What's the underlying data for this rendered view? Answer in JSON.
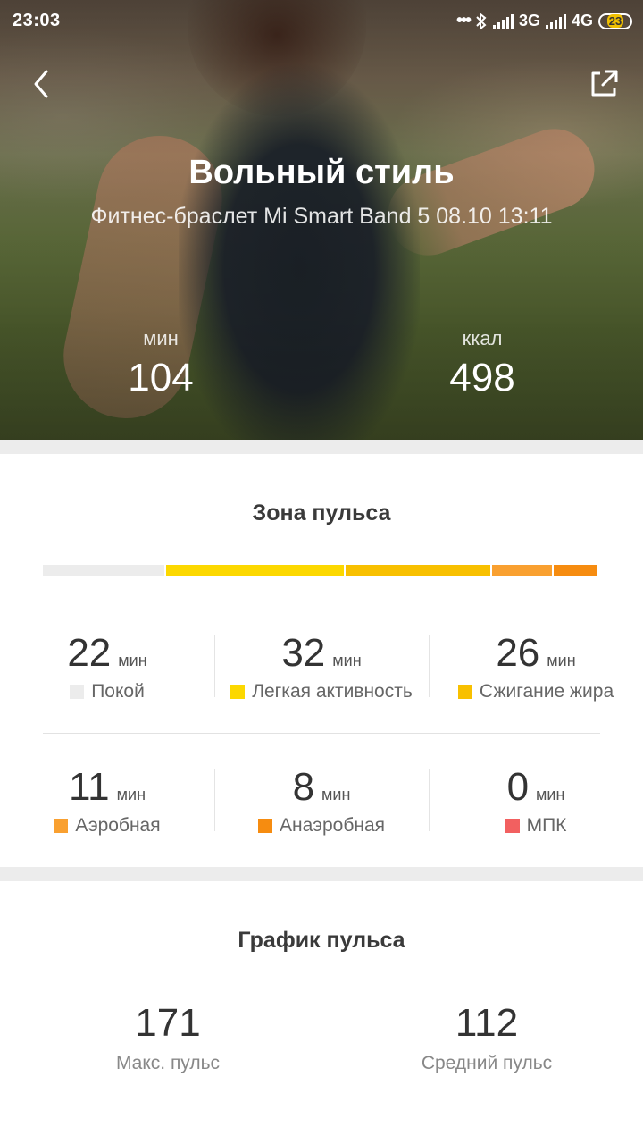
{
  "status_bar": {
    "time": "23:03",
    "net1": "3G",
    "net2": "4G",
    "battery": "23"
  },
  "header": {
    "title": "Вольный стиль",
    "subtitle": "Фитнес-браслет Mi Smart Band 5 08.10 13:11"
  },
  "summary": {
    "duration_unit": "мин",
    "duration_value": "104",
    "calories_unit": "ккал",
    "calories_value": "498"
  },
  "heart_zone": {
    "title": "Зона пульса",
    "zones": [
      {
        "value": "22",
        "unit": "мин",
        "label": "Покой",
        "color": "#ececec",
        "minutes": 22
      },
      {
        "value": "32",
        "unit": "мин",
        "label": "Легкая активность",
        "color": "#fcd800",
        "minutes": 32
      },
      {
        "value": "26",
        "unit": "мин",
        "label": "Сжигание жира",
        "color": "#f8c000",
        "minutes": 26
      },
      {
        "value": "11",
        "unit": "мин",
        "label": "Аэробная",
        "color": "#f9a030",
        "minutes": 11
      },
      {
        "value": "8",
        "unit": "мин",
        "label": "Анаэробная",
        "color": "#f68c10",
        "minutes": 8
      },
      {
        "value": "0",
        "unit": "мин",
        "label": "МПК",
        "color": "#f26060",
        "minutes": 0
      }
    ]
  },
  "heart_chart": {
    "title": "График пульса",
    "max_value": "171",
    "max_label": "Макс. пульс",
    "avg_value": "112",
    "avg_label": "Средний пульс"
  },
  "icons": {
    "back": "chevron-left-icon",
    "share": "share-icon",
    "bluetooth": "bluetooth-icon",
    "signal": "signal-icon",
    "battery": "battery-icon"
  }
}
